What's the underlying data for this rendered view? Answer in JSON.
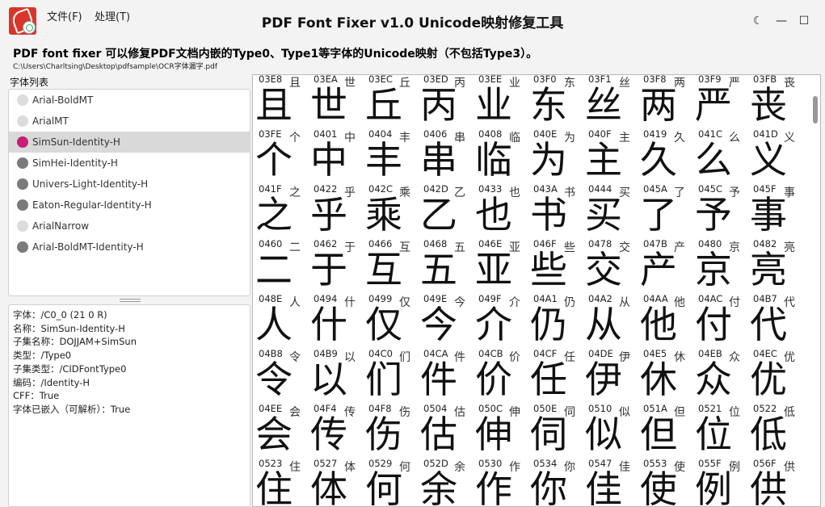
{
  "window": {
    "title": "PDF Font Fixer v1.0  Unicode映射修复工具",
    "menus": [
      {
        "label": "文件(F)"
      },
      {
        "label": "处理(T)"
      }
    ],
    "controls": {
      "theme": "☾",
      "minimize": "—",
      "maximize": "☐",
      "close": "✕"
    }
  },
  "header": {
    "description": "PDF font fixer 可以修复PDF文档内嵌的Type0、Type1等字体的Unicode映射（不包括Type3）。",
    "path": "C:\\Users\\Charltsing\\Desktop\\pdfsample\\OCR字体漏字.pdf"
  },
  "fontlist": {
    "label": "字体列表",
    "items": [
      {
        "label": "Arial-BoldMT",
        "color": "#dcdcdc"
      },
      {
        "label": "ArialMT",
        "color": "#dcdcdc"
      },
      {
        "label": "SimSun-Identity-H",
        "color": "#c81e78"
      },
      {
        "label": "SimHei-Identity-H",
        "color": "#7a7a7a"
      },
      {
        "label": "Univers-Light-Identity-H",
        "color": "#7a7a7a"
      },
      {
        "label": "Eaton-Regular-Identity-H",
        "color": "#7a7a7a"
      },
      {
        "label": "ArialNarrow",
        "color": "#dcdcdc"
      },
      {
        "label": "Arial-BoldMT-Identity-H",
        "color": "#7a7a7a"
      }
    ],
    "selected_index": 2
  },
  "info": {
    "lines": [
      "字体：/C0_0 (21 0 R)",
      "名称：SimSun-Identity-H",
      "子集名称：DOJJAM+SimSun",
      "类型：/Type0",
      "子集类型：/CIDFontType0",
      "编码：/Identity-H",
      "CFF：True",
      "字体已嵌入（可解析）：True"
    ]
  },
  "glyphs": [
    {
      "code": "03E8",
      "ch": "且"
    },
    {
      "code": "03EA",
      "ch": "世"
    },
    {
      "code": "03EC",
      "ch": "丘"
    },
    {
      "code": "03ED",
      "ch": "丙"
    },
    {
      "code": "03EE",
      "ch": "业"
    },
    {
      "code": "03F0",
      "ch": "东"
    },
    {
      "code": "03F1",
      "ch": "丝"
    },
    {
      "code": "03F8",
      "ch": "两"
    },
    {
      "code": "03F9",
      "ch": "严"
    },
    {
      "code": "03FB",
      "ch": "丧"
    },
    {
      "code": "03FE",
      "ch": "个"
    },
    {
      "code": "0401",
      "ch": "中"
    },
    {
      "code": "0404",
      "ch": "丰"
    },
    {
      "code": "0406",
      "ch": "串"
    },
    {
      "code": "0408",
      "ch": "临"
    },
    {
      "code": "040E",
      "ch": "为"
    },
    {
      "code": "040F",
      "ch": "主"
    },
    {
      "code": "0419",
      "ch": "久"
    },
    {
      "code": "041C",
      "ch": "么"
    },
    {
      "code": "041D",
      "ch": "义"
    },
    {
      "code": "041F",
      "ch": "之"
    },
    {
      "code": "0422",
      "ch": "乎"
    },
    {
      "code": "042C",
      "ch": "乘"
    },
    {
      "code": "042D",
      "ch": "乙"
    },
    {
      "code": "0433",
      "ch": "也"
    },
    {
      "code": "043A",
      "ch": "书"
    },
    {
      "code": "0444",
      "ch": "买"
    },
    {
      "code": "045A",
      "ch": "了"
    },
    {
      "code": "045C",
      "ch": "予"
    },
    {
      "code": "045F",
      "ch": "事"
    },
    {
      "code": "0460",
      "ch": "二"
    },
    {
      "code": "0462",
      "ch": "于"
    },
    {
      "code": "0466",
      "ch": "互"
    },
    {
      "code": "0468",
      "ch": "五"
    },
    {
      "code": "046E",
      "ch": "亚"
    },
    {
      "code": "046F",
      "ch": "些"
    },
    {
      "code": "0478",
      "ch": "交"
    },
    {
      "code": "047B",
      "ch": "产"
    },
    {
      "code": "0480",
      "ch": "京"
    },
    {
      "code": "0482",
      "ch": "亮"
    },
    {
      "code": "048E",
      "ch": "人"
    },
    {
      "code": "0494",
      "ch": "什"
    },
    {
      "code": "0499",
      "ch": "仅"
    },
    {
      "code": "049E",
      "ch": "今"
    },
    {
      "code": "049F",
      "ch": "介"
    },
    {
      "code": "04A1",
      "ch": "仍"
    },
    {
      "code": "04A2",
      "ch": "从"
    },
    {
      "code": "04AA",
      "ch": "他"
    },
    {
      "code": "04AC",
      "ch": "付"
    },
    {
      "code": "04B7",
      "ch": "代"
    },
    {
      "code": "04B8",
      "ch": "令"
    },
    {
      "code": "04B9",
      "ch": "以"
    },
    {
      "code": "04C0",
      "ch": "们"
    },
    {
      "code": "04CA",
      "ch": "件"
    },
    {
      "code": "04CB",
      "ch": "价"
    },
    {
      "code": "04CF",
      "ch": "任"
    },
    {
      "code": "04DE",
      "ch": "伊"
    },
    {
      "code": "04E5",
      "ch": "休"
    },
    {
      "code": "04EB",
      "ch": "众"
    },
    {
      "code": "04EC",
      "ch": "优"
    },
    {
      "code": "04EE",
      "ch": "会"
    },
    {
      "code": "04F4",
      "ch": "传"
    },
    {
      "code": "04F8",
      "ch": "伤"
    },
    {
      "code": "0504",
      "ch": "估"
    },
    {
      "code": "050C",
      "ch": "伸"
    },
    {
      "code": "050E",
      "ch": "伺"
    },
    {
      "code": "0510",
      "ch": "似"
    },
    {
      "code": "051A",
      "ch": "但"
    },
    {
      "code": "0521",
      "ch": "位"
    },
    {
      "code": "0522",
      "ch": "低"
    },
    {
      "code": "0523",
      "ch": "住"
    },
    {
      "code": "0527",
      "ch": "体"
    },
    {
      "code": "0529",
      "ch": "何"
    },
    {
      "code": "052D",
      "ch": "余"
    },
    {
      "code": "0530",
      "ch": "作"
    },
    {
      "code": "0534",
      "ch": "你"
    },
    {
      "code": "0547",
      "ch": "佳"
    },
    {
      "code": "0553",
      "ch": "使"
    },
    {
      "code": "055F",
      "ch": "例"
    },
    {
      "code": "056F",
      "ch": "供"
    }
  ]
}
